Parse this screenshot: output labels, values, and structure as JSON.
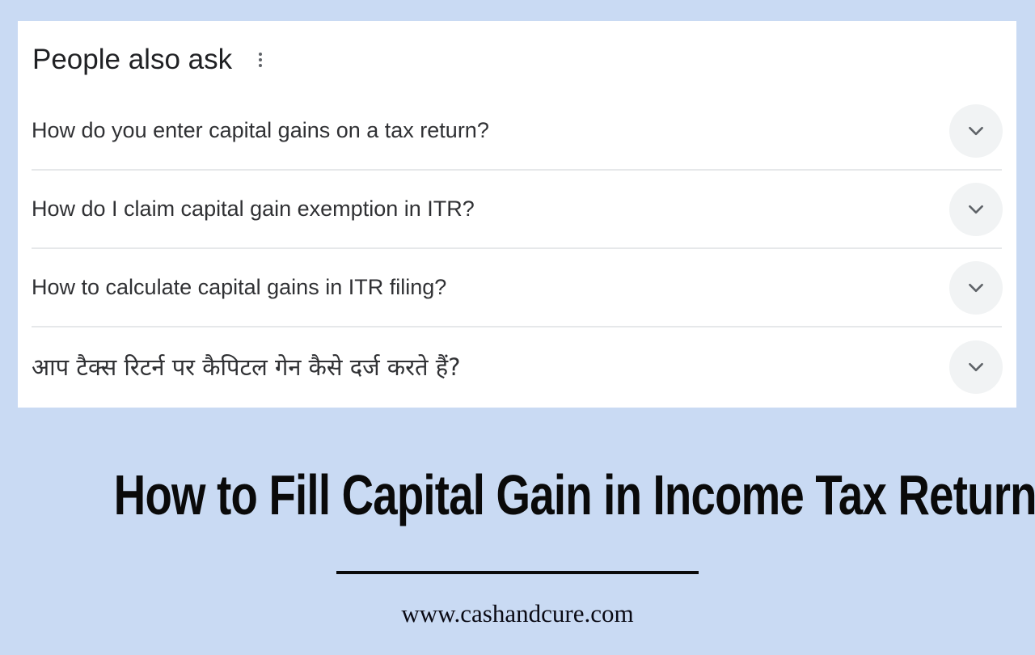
{
  "paa": {
    "title": "People also ask",
    "menu_icon": "more-vert-icon",
    "questions": [
      {
        "text": "How do you enter capital gains on a tax return?",
        "icon": "chevron-down-icon"
      },
      {
        "text": "How do I claim capital gain exemption in ITR?",
        "icon": "chevron-down-icon"
      },
      {
        "text": "How to calculate capital gains in ITR filing?",
        "icon": "chevron-down-icon"
      },
      {
        "text": "आप टैक्स रिटर्न पर कैपिटल गेन कैसे दर्ज करते हैं?",
        "icon": "chevron-down-icon"
      }
    ]
  },
  "headline": "How to Fill Capital Gain in Income Tax Return",
  "website": "www.cashandcure.com",
  "colors": {
    "background": "#c9daf3",
    "card": "#ffffff",
    "chevron_bg": "#f1f3f4",
    "text": "#202124"
  }
}
